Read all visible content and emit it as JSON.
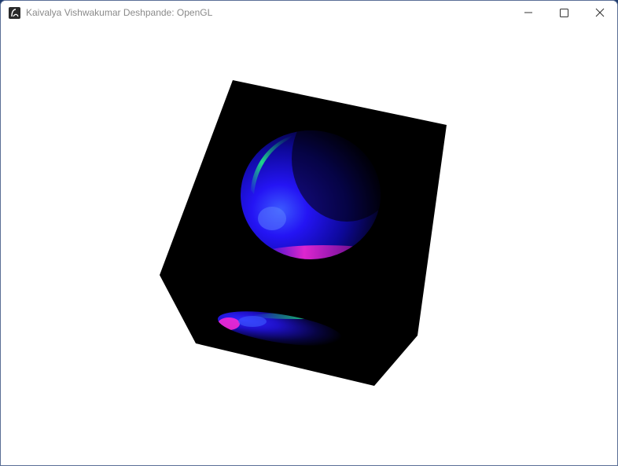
{
  "window": {
    "title": "Kaivalya Vishwakumar Deshpande: OpenGL",
    "icon": "app-icon",
    "controls": {
      "minimize_icon": "minimize-icon",
      "maximize_icon": "maximize-icon",
      "close_icon": "close-icon"
    }
  },
  "colors": {
    "clear_color": "#ffffff",
    "cube_color": "#000000",
    "sphere_primary": "#2a14ff",
    "sphere_highlight_magenta": "#ff2ad2",
    "sphere_highlight_green": "#1fe08a"
  },
  "scene": {
    "objects": [
      "rotated-black-cube",
      "lit-sphere",
      "sphere-reflection"
    ]
  }
}
